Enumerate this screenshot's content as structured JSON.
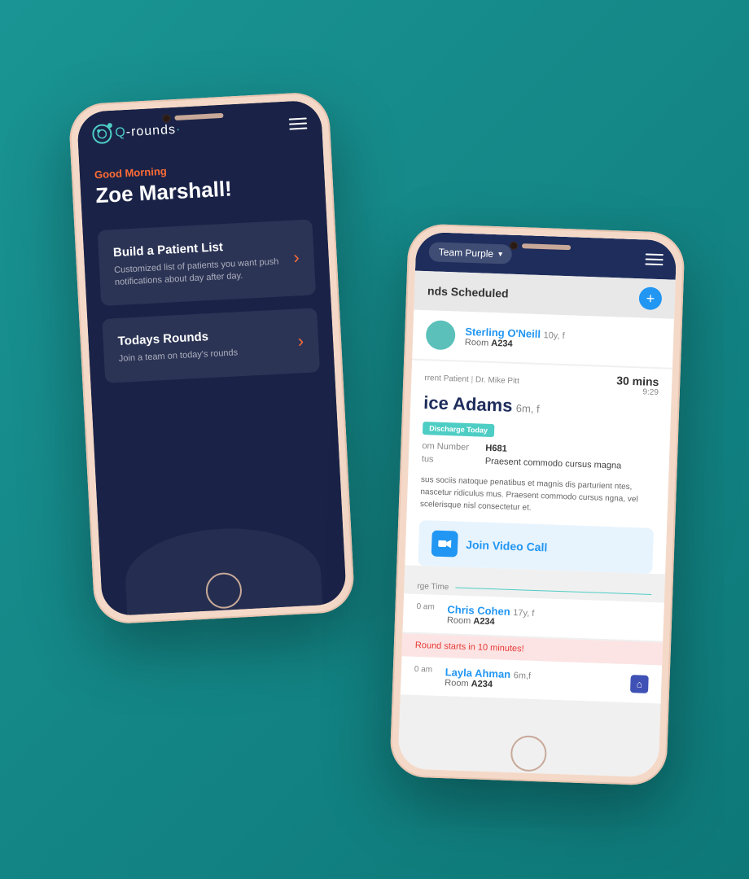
{
  "background": {
    "color": "#1a9494"
  },
  "phone_left": {
    "logo": {
      "text": "rounds",
      "icon": "Q"
    },
    "hamburger_label": "menu",
    "greeting": {
      "label": "Good Morning",
      "name": "Zoe Marshall!"
    },
    "menu_cards": [
      {
        "title": "Build a Patient List",
        "description": "Customized list of patients you want push notifications about day after day.",
        "arrow": "›"
      },
      {
        "title": "Todays Rounds",
        "description": "Join a team on today's rounds",
        "arrow": "›"
      }
    ]
  },
  "phone_right": {
    "team_selector": {
      "label": "Team Purple",
      "arrow": "▾"
    },
    "section": {
      "title": "nds Scheduled",
      "add_button": "+"
    },
    "patients": [
      {
        "name": "Sterling O'Neill",
        "age": "10y, f",
        "room_label": "Room",
        "room": "A234",
        "is_current": false
      }
    ],
    "current_patient": {
      "label": "rrent Patient",
      "doctor": "Dr. Mike Pitt",
      "time_label": "30 mins",
      "time": "9:29",
      "name": "ice Adams",
      "age": "6m, f",
      "discharge_badge": "Discharge Today",
      "room_number_label": "om Number",
      "room_number": "H681",
      "status_label": "tus",
      "status": "Praesent commodo cursus magna",
      "description": "sus sociis natoque penatibus et magnis dis parturient ntes, nascetur ridiculus mus. Praesent commodo cursus ngna, vel scelerisque nisl consectetur et.",
      "video_call_label": "Join Video Call"
    },
    "discharge_section": {
      "label": "rge Time"
    },
    "post_discharge_patients": [
      {
        "time": "0 am",
        "name": "Chris Cohen",
        "age": "17y, f",
        "room": "A234",
        "alert": "Round starts in 10 minutes!"
      },
      {
        "time": "0 am",
        "name": "Layla Ahman",
        "age": "6m,f",
        "room": "A234",
        "has_home_icon": true
      }
    ]
  }
}
